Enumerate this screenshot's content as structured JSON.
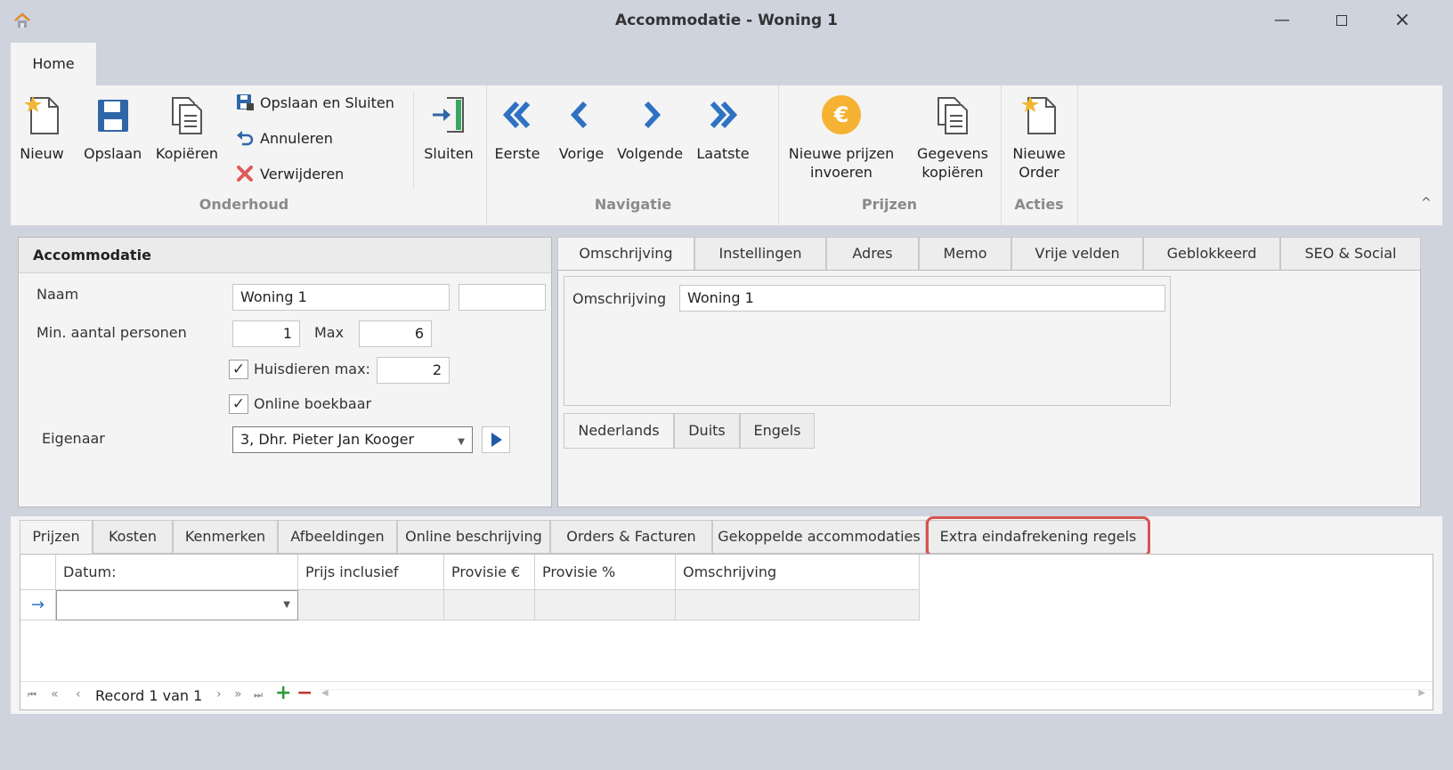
{
  "window": {
    "title": "Accommodatie - Woning 1",
    "minimize_icon": "minimize-icon",
    "maximize_icon": "maximize-icon",
    "close_icon": "close-icon"
  },
  "ribbon": {
    "tab": "Home",
    "onderhoud": {
      "label": "Onderhoud",
      "nieuw": "Nieuw",
      "opslaan": "Opslaan",
      "kopieren": "Kopiëren",
      "opslaan_sluiten": "Opslaan en Sluiten",
      "annuleren": "Annuleren",
      "verwijderen": "Verwijderen",
      "sluiten": "Sluiten"
    },
    "navigatie": {
      "label": "Navigatie",
      "eerste": "Eerste",
      "vorige": "Vorige",
      "volgende": "Volgende",
      "laatste": "Laatste"
    },
    "prijzen": {
      "label": "Prijzen",
      "nieuwe_prijzen_1": "Nieuwe prijzen",
      "nieuwe_prijzen_2": "invoeren",
      "gegevens_1": "Gegevens",
      "gegevens_2": "kopiëren"
    },
    "acties": {
      "label": "Acties",
      "nieuwe_order_1": "Nieuwe",
      "nieuwe_order_2": "Order"
    },
    "collapse": "^"
  },
  "accommodatie": {
    "header": "Accommodatie",
    "naam_label": "Naam",
    "naam_value": "Woning 1",
    "naam_extra": "",
    "min_label": "Min. aantal personen",
    "min_value": "1",
    "max_label": "Max",
    "max_value": "6",
    "huisdieren_label": "Huisdieren max:",
    "huisdieren_value": "2",
    "online_label": "Online boekbaar",
    "eigenaar_label": "Eigenaar",
    "eigenaar_value": "3, Dhr. Pieter Jan Kooger",
    "check_mark": "✓"
  },
  "right_tabs": [
    "Omschrijving",
    "Instellingen",
    "Adres",
    "Memo",
    "Vrije velden",
    "Geblokkeerd",
    "SEO & Social"
  ],
  "omschrijving": {
    "label": "Omschrijving",
    "value": "Woning 1",
    "lang_tabs": [
      "Nederlands",
      "Duits",
      "Engels"
    ]
  },
  "bottom_tabs": [
    "Prijzen",
    "Kosten",
    "Kenmerken",
    "Afbeeldingen",
    "Online beschrijving",
    "Orders & Facturen",
    "Gekoppelde accommodaties",
    "Extra eindafrekening regels"
  ],
  "highlight_color": "#d9534f",
  "grid": {
    "columns": [
      "Datum:",
      "Prijs inclusief",
      "Provisie €",
      "Provisie %",
      "Omschrijving"
    ],
    "row_indicator": "→"
  },
  "navigator": {
    "record_text": "Record 1 van 1",
    "first": "⏮",
    "prev_page": "«",
    "prev": "‹",
    "next": "›",
    "next_page": "»",
    "last": "⏭",
    "add": "+",
    "remove": "−"
  }
}
